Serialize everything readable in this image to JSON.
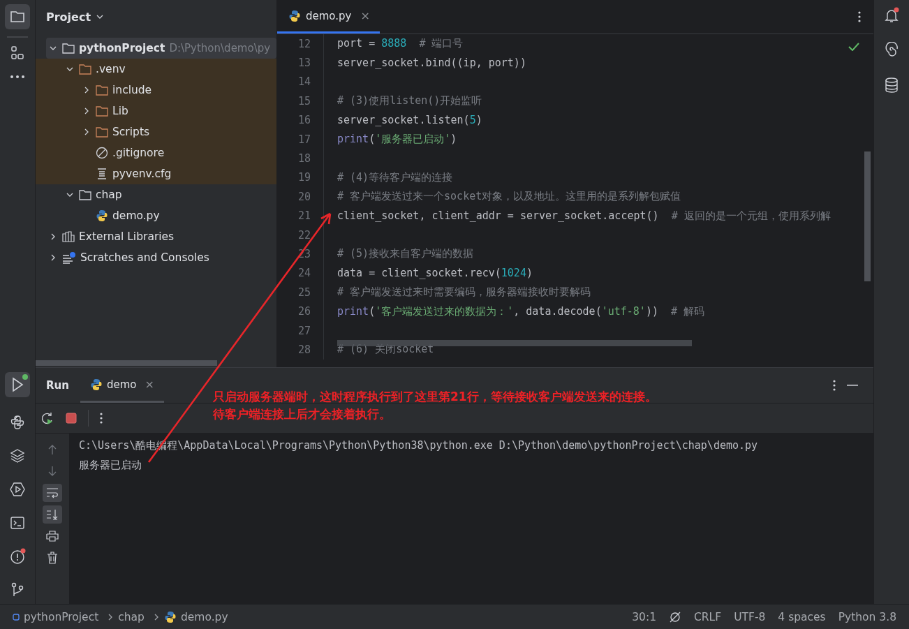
{
  "project_panel": {
    "title": "Project",
    "tree": [
      {
        "name": "pythonProject",
        "path": "D:\\Python\\demo\\py",
        "kind": "folder",
        "expanded": true,
        "selected": true,
        "excluded": false,
        "children": [
          {
            "name": ".venv",
            "kind": "folder",
            "expanded": true,
            "selected": false,
            "excluded": true,
            "children": [
              {
                "name": "include",
                "kind": "folder",
                "expanded": false,
                "selected": false,
                "excluded": true
              },
              {
                "name": "Lib",
                "kind": "folder",
                "expanded": false,
                "selected": false,
                "excluded": true
              },
              {
                "name": "Scripts",
                "kind": "folder",
                "expanded": false,
                "selected": false,
                "excluded": true
              },
              {
                "name": ".gitignore",
                "kind": "ignore",
                "selected": false,
                "excluded": true
              },
              {
                "name": "pyvenv.cfg",
                "kind": "text",
                "selected": false,
                "excluded": true
              }
            ]
          },
          {
            "name": "chap",
            "kind": "folder",
            "expanded": true,
            "selected": false,
            "excluded": false,
            "children": [
              {
                "name": "demo.py",
                "kind": "python",
                "selected": false,
                "excluded": false
              }
            ]
          }
        ]
      },
      {
        "name": "External Libraries",
        "kind": "libraries",
        "expanded": false,
        "selected": false,
        "excluded": false
      },
      {
        "name": "Scratches and Consoles",
        "kind": "scratches",
        "expanded": false,
        "selected": false,
        "excluded": false
      }
    ]
  },
  "editor": {
    "tabs": [
      {
        "label": "demo.py",
        "selected": true,
        "close": "×"
      }
    ],
    "lines": [
      {
        "number": "12",
        "tokens": [
          {
            "kind": "plain",
            "text": "port = "
          },
          {
            "kind": "number",
            "text": "8888"
          },
          {
            "kind": "comment",
            "text": "  # 端口号"
          }
        ]
      },
      {
        "number": "13",
        "tokens": [
          {
            "kind": "plain",
            "text": "server_socket.bind((ip, port))"
          }
        ]
      },
      {
        "number": "14"
      },
      {
        "number": "15",
        "tokens": [
          {
            "kind": "comment",
            "text": "# (3)使用listen()开始监听"
          }
        ]
      },
      {
        "number": "16",
        "tokens": [
          {
            "kind": "plain",
            "text": "server_socket.listen("
          },
          {
            "kind": "number",
            "text": "5"
          },
          {
            "kind": "plain",
            "text": ")"
          }
        ]
      },
      {
        "number": "17",
        "tokens": [
          {
            "kind": "builtin",
            "text": "print"
          },
          {
            "kind": "plain",
            "text": "("
          },
          {
            "kind": "string",
            "text": "'服务器已启动'"
          },
          {
            "kind": "plain",
            "text": ")"
          }
        ]
      },
      {
        "number": "18"
      },
      {
        "number": "19",
        "tokens": [
          {
            "kind": "comment",
            "text": "# (4)等待客户端的连接"
          }
        ]
      },
      {
        "number": "20",
        "tokens": [
          {
            "kind": "comment",
            "text": "# 客户端发送过来一个socket对象，以及地址。这里用的是系列解包赋值"
          }
        ]
      },
      {
        "number": "21",
        "tokens": [
          {
            "kind": "plain",
            "text": "client_socket, client_addr = server_socket.accept()"
          },
          {
            "kind": "comment",
            "text": "  # 返回的是一个元组，使用系列解"
          }
        ]
      },
      {
        "number": "22"
      },
      {
        "number": "23",
        "tokens": [
          {
            "kind": "comment",
            "text": "# (5)接收来自客户端的数据"
          }
        ]
      },
      {
        "number": "24",
        "tokens": [
          {
            "kind": "plain",
            "text": "data = client_socket.recv("
          },
          {
            "kind": "number",
            "text": "1024"
          },
          {
            "kind": "plain",
            "text": ")"
          }
        ]
      },
      {
        "number": "25",
        "tokens": [
          {
            "kind": "comment",
            "text": "# 客户端发送过来时需要编码，服务器端接收时要解码"
          }
        ]
      },
      {
        "number": "26",
        "tokens": [
          {
            "kind": "builtin",
            "text": "print"
          },
          {
            "kind": "plain",
            "text": "("
          },
          {
            "kind": "string",
            "text": "'客户端发送过来的数据为：'"
          },
          {
            "kind": "plain",
            "text": ", data.decode("
          },
          {
            "kind": "string",
            "text": "'utf-8'"
          },
          {
            "kind": "plain",
            "text": "))"
          },
          {
            "kind": "comment",
            "text": "  # 解码"
          }
        ]
      },
      {
        "number": "27"
      },
      {
        "number": "28",
        "tokens": [
          {
            "kind": "comment",
            "text": "# (6) 关闭socket"
          }
        ]
      }
    ]
  },
  "run_panel": {
    "title": "Run",
    "tabs": [
      {
        "label": "demo",
        "selected": true,
        "close": "×"
      }
    ],
    "tools": [
      {
        "kind": "up",
        "on": false
      },
      {
        "kind": "down",
        "on": false
      },
      {
        "kind": "wrap",
        "on": true
      },
      {
        "kind": "scroll-end",
        "on": true
      },
      {
        "kind": "print",
        "on": false
      },
      {
        "kind": "delete",
        "on": false
      }
    ],
    "console": [
      "C:\\Users\\酷电编程\\AppData\\Local\\Programs\\Python\\Python38\\python.exe D:\\Python\\demo\\pythonProject\\chap\\demo.py",
      "服务器已启动"
    ]
  },
  "annotation": {
    "lines": [
      "只启动服务器端时，这时程序执行到了这里第21行，等待接收客户端发送来的连接。",
      "待客户端连接上后才会接着执行。"
    ]
  },
  "status_bar": {
    "breadcrumbs": [
      "pythonProject",
      "chap",
      "demo.py"
    ],
    "items": [
      "30:1",
      "CRLF",
      "UTF-8",
      "4 spaces",
      "Python 3.8"
    ]
  }
}
